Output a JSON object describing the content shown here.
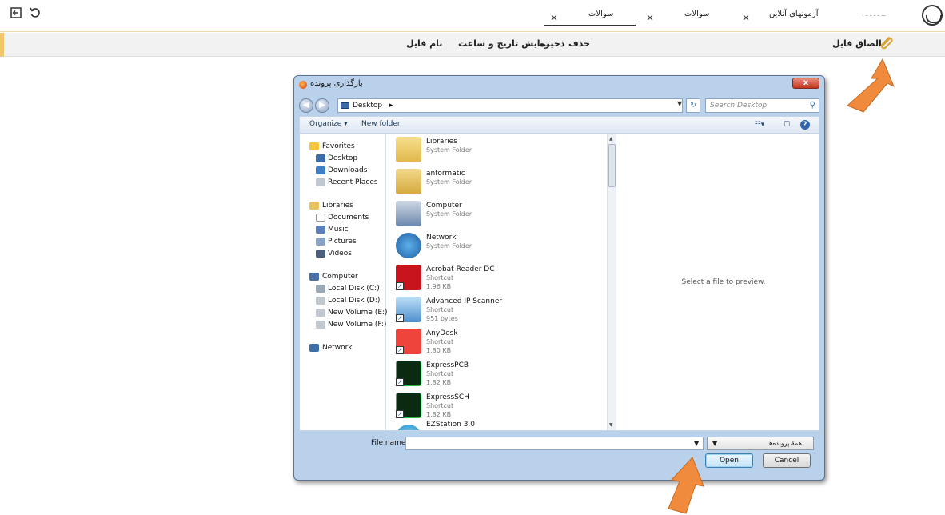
{
  "topbar": {
    "tabs": [
      {
        "label": "آزمونهای آنلاین"
      },
      {
        "label": "سوالات"
      },
      {
        "label": "سوالات"
      }
    ],
    "close_glyph": "×",
    "user_name": ". ــ ـ ـ ـ ـ",
    "icons": [
      "exit-icon",
      "undo-icon",
      "user-avatar"
    ]
  },
  "attachbar": {
    "attach_label": "الصاق فایل",
    "columns": {
      "delete": "حذف",
      "save": "ذخیره",
      "show_datetime": "نمایش تاریخ و ساعت",
      "file_name": "نام فایل"
    }
  },
  "dialog": {
    "title": "بارگذاری پرونده",
    "close_glyph": "x",
    "address": {
      "location": "Desktop",
      "separator": "▸"
    },
    "search_placeholder": "Search Desktop",
    "commands": {
      "organize": "Organize ▾",
      "new_folder": "New folder"
    },
    "nav": {
      "favorites": {
        "label": "Favorites",
        "items": [
          "Desktop",
          "Downloads",
          "Recent Places"
        ]
      },
      "libraries": {
        "label": "Libraries",
        "items": [
          "Documents",
          "Music",
          "Pictures",
          "Videos"
        ]
      },
      "computer": {
        "label": "Computer",
        "items": [
          "Local Disk (C:)",
          "Local Disk (D:)",
          "New Volume (E:)",
          "New Volume (F:)"
        ]
      },
      "network": {
        "label": "Network"
      }
    },
    "files": [
      {
        "name": "Libraries",
        "type": "System Folder",
        "size": ""
      },
      {
        "name": "anformatic",
        "type": "System Folder",
        "size": ""
      },
      {
        "name": "Computer",
        "type": "System Folder",
        "size": ""
      },
      {
        "name": "Network",
        "type": "System Folder",
        "size": ""
      },
      {
        "name": "Acrobat Reader DC",
        "type": "Shortcut",
        "size": "1.96 KB"
      },
      {
        "name": "Advanced IP Scanner",
        "type": "Shortcut",
        "size": "951 bytes"
      },
      {
        "name": "AnyDesk",
        "type": "Shortcut",
        "size": "1.80 KB"
      },
      {
        "name": "ExpressPCB",
        "type": "Shortcut",
        "size": "1.82 KB"
      },
      {
        "name": "ExpressSCH",
        "type": "Shortcut",
        "size": "1.82 KB"
      },
      {
        "name": "EZStation 3.0",
        "type": "",
        "size": ""
      }
    ],
    "preview_text": "Select a file to preview.",
    "file_name_label": "File name:",
    "file_name_value": "",
    "filter_value": "همهٔ پرونده‌ها",
    "open_label": "Open",
    "cancel_label": "Cancel"
  },
  "colors": {
    "accent_bar": "#f3c56a",
    "callout": "#f08a3c",
    "dialog_frame": "#b9d1ea"
  }
}
